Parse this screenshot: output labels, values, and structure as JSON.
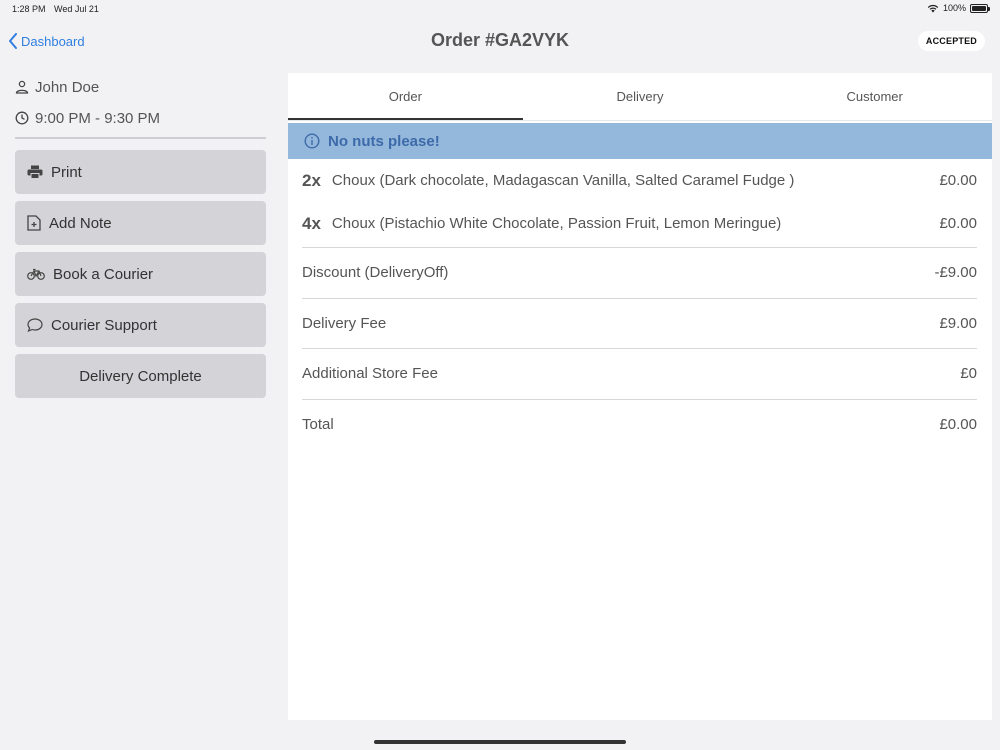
{
  "status_bar": {
    "time": "1:28 PM",
    "date": "Wed Jul 21",
    "battery": "100%",
    "battery_level": 1.0
  },
  "header": {
    "back_label": "Dashboard",
    "title": "Order #GA2VYK",
    "status": "ACCEPTED"
  },
  "sidebar": {
    "customer_name": "John Doe",
    "time_slot": "9:00 PM - 9:30 PM",
    "actions": [
      {
        "label": "Print",
        "icon": "printer-icon"
      },
      {
        "label": "Add Note",
        "icon": "add-note-icon"
      },
      {
        "label": "Book a Courier",
        "icon": "bicycle-icon"
      },
      {
        "label": "Courier Support",
        "icon": "chat-bubble-icon"
      },
      {
        "label": "Delivery Complete",
        "icon": ""
      }
    ]
  },
  "tabs": [
    {
      "label": "Order",
      "active": true
    },
    {
      "label": "Delivery",
      "active": false
    },
    {
      "label": "Customer",
      "active": false
    }
  ],
  "note": "No nuts please!",
  "items": [
    {
      "qty": "2x",
      "name": "Choux (Dark chocolate, Madagascan Vanilla, Salted Caramel Fudge )",
      "price": "£0.00"
    },
    {
      "qty": "4x",
      "name": "Choux (Pistachio White Chocolate, Passion Fruit, Lemon Meringue)",
      "price": "£0.00"
    }
  ],
  "fees": [
    {
      "label": "Discount (DeliveryOff)",
      "value": "-£9.00"
    },
    {
      "label": "Delivery Fee",
      "value": "£9.00"
    },
    {
      "label": "Additional Store Fee",
      "value": "£0"
    },
    {
      "label": "Total",
      "value": "£0.00"
    }
  ],
  "colors": {
    "accent": "#2f7ee0",
    "note_banner_bg": "#94b7dc",
    "note_banner_text": "#3d6aa8",
    "button_bg": "#d3d3d8"
  }
}
